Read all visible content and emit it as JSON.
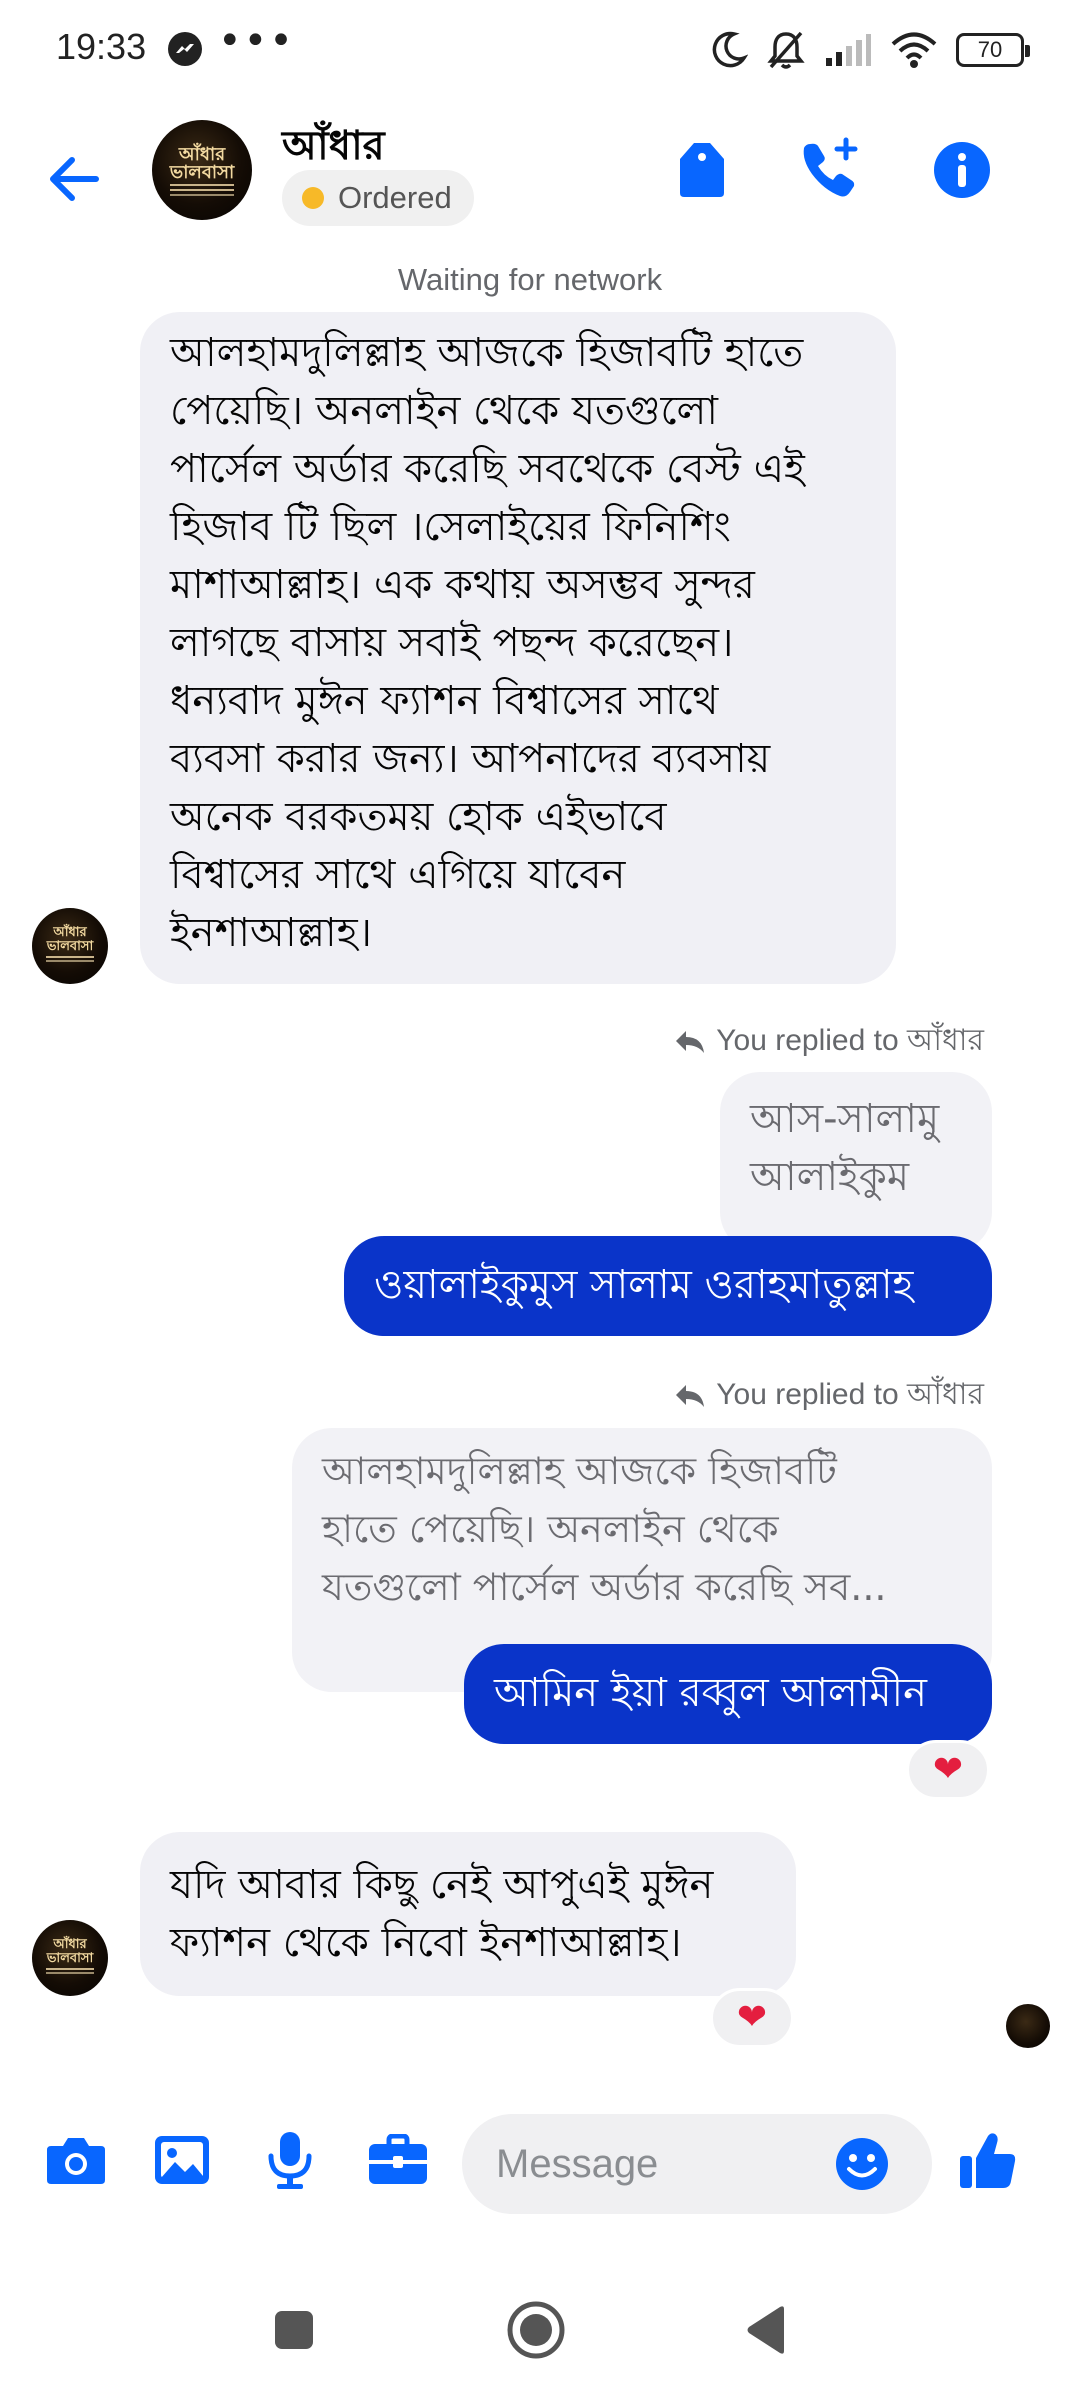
{
  "status_bar": {
    "time": "19:33",
    "battery": "70"
  },
  "header": {
    "contact_name": "আঁধার",
    "order_status": "Ordered",
    "avatar_text": "আঁধার ভালবাসা"
  },
  "network_notice": "Waiting for network",
  "messages": {
    "m1": {
      "lines": [
        "আলহামদুলিল্লাহ আজকে হিজাবটি হাতে",
        "পেয়েছি। অনলাইন থেকে যতগুলো",
        "পার্সেল অর্ডার করেছি সবথেকে বেস্ট এই",
        "হিজাব টি ছিল ।সেলাইয়ের ফিনিশিং",
        "মাশাআল্লাহ। এক কথায় অসম্ভব সুন্দর",
        "লাগছে বাসায় সবাই পছন্দ করেছেন।",
        "ধন্যবাদ মুঈন ফ্যাশন বিশ্বাসের সাথে",
        "ব্যবসা করার জন্য। আপনাদের ব্যবসায়",
        "অনেক বরকতময় হোক এইভাবে",
        "বিশ্বাসের সাথে এগিয়ে যাবেন",
        "ইনশাআল্লাহ।"
      ]
    },
    "reply1": {
      "note": "You replied to আঁধার",
      "quote_lines": [
        "আস-সালামু",
        "আলাইকুম"
      ],
      "text": "ওয়ালাইকুমুস সালাম ওরাহমাতুল্লাহ"
    },
    "reply2": {
      "note": "You replied to আঁধার",
      "quote_lines": [
        "আলহামদুলিল্লাহ আজকে হিজাবটি",
        "হাতে পেয়েছি। অনলাইন থেকে",
        "যতগুলো পার্সেল অর্ডার করেছি সব..."
      ],
      "text": "আমিন ইয়া রব্বুল আলামীন",
      "reaction": "❤"
    },
    "m2": {
      "lines": [
        "যদি আবার কিছু নেই আপুএই মুঈন",
        "ফ্যাশন থেকে নিবো ইনশাআল্লাহ।"
      ],
      "reaction": "❤"
    }
  },
  "composer": {
    "placeholder": "Message"
  },
  "colors": {
    "accent": "#0866ff",
    "outgoing_bubble": "#0a34c9",
    "incoming_bubble": "#f0f0f5",
    "heart": "#e41e3f",
    "ordered_dot": "#f7b928"
  }
}
